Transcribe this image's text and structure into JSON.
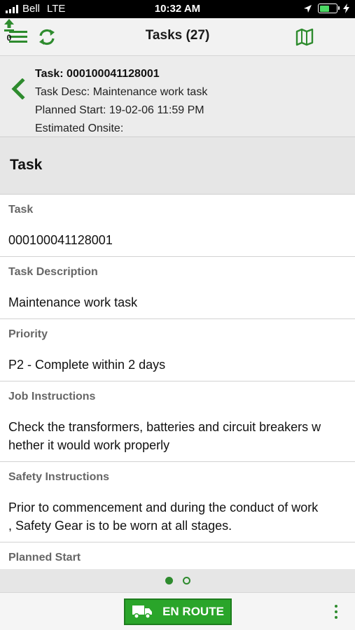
{
  "status_bar": {
    "carrier": "Bell",
    "network": "LTE",
    "time": "10:32 AM",
    "battery_percent": 60
  },
  "header": {
    "title": "Tasks (27)",
    "upload_count": "0",
    "icons": [
      "menu-icon",
      "refresh-icon",
      "map-icon",
      "upload-icon"
    ]
  },
  "summary": {
    "task_line": "Task: 000100041128001",
    "desc_line": "Task Desc: Maintenance work task",
    "planned_line": "Planned Start: 19-02-06 11:59 PM",
    "onsite_line": "Estimated Onsite:"
  },
  "section": {
    "title": "Task"
  },
  "fields": [
    {
      "label": "Task",
      "value": "000100041128001"
    },
    {
      "label": "Task Description",
      "value": "Maintenance work task"
    },
    {
      "label": "Priority",
      "value": "P2 - Complete within 2 days"
    },
    {
      "label": "Job Instructions",
      "value": "Check the transformers, batteries and circuit breakers w\nhether it would work properly"
    },
    {
      "label": "Safety Instructions",
      "value": "Prior to commencement and during the conduct of work\n, Safety Gear is to be worn at all stages."
    },
    {
      "label": "Planned Start",
      "value": ""
    }
  ],
  "pager": {
    "pages": 2,
    "current": 1
  },
  "actions": {
    "en_route_label": "EN ROUTE"
  },
  "colors": {
    "accent": "#2e8b2e",
    "button": "#2aa52a"
  }
}
